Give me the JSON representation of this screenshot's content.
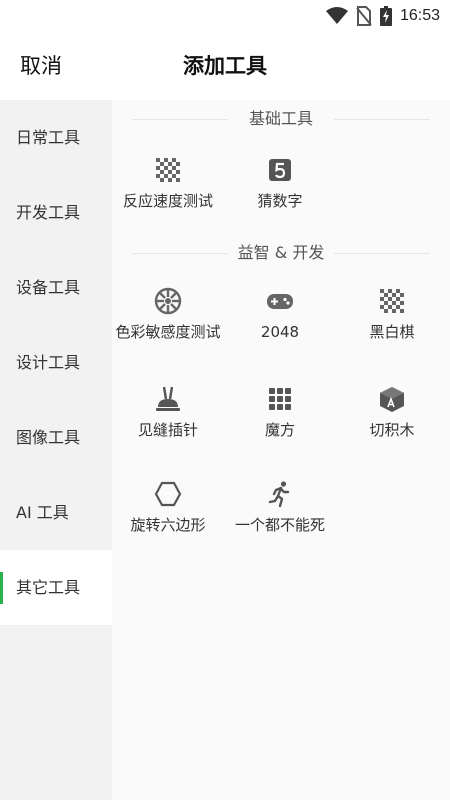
{
  "status_bar": {
    "time": "16:53",
    "icons": [
      "wifi-icon",
      "no-sim-icon",
      "battery-charging-icon"
    ]
  },
  "header": {
    "cancel_label": "取消",
    "title": "添加工具"
  },
  "sidebar": {
    "accent_color": "#2bb24c",
    "items": [
      {
        "label": "日常工具",
        "active": false
      },
      {
        "label": "开发工具",
        "active": false
      },
      {
        "label": "设备工具",
        "active": false
      },
      {
        "label": "设计工具",
        "active": false
      },
      {
        "label": "图像工具",
        "active": false
      },
      {
        "label": "AI 工具",
        "active": false
      },
      {
        "label": "其它工具",
        "active": true
      }
    ]
  },
  "sections": [
    {
      "title": "基础工具",
      "tools": [
        {
          "label": "反应速度测试",
          "icon": "checkerboard-icon"
        },
        {
          "label": "猜数字",
          "icon": "number-five-icon"
        }
      ]
    },
    {
      "title": "益智 & 开发",
      "tools": [
        {
          "label": "色彩敏感度测试",
          "icon": "color-wheel-icon"
        },
        {
          "label": "2048",
          "icon": "gamepad-icon"
        },
        {
          "label": "黑白棋",
          "icon": "checkerboard-icon"
        },
        {
          "label": "见缝插针",
          "icon": "pin-icon"
        },
        {
          "label": "魔方",
          "icon": "grid-icon"
        },
        {
          "label": "切积木",
          "icon": "block-cube-icon"
        },
        {
          "label": "旋转六边形",
          "icon": "hexagon-icon"
        },
        {
          "label": "一个都不能死",
          "icon": "running-icon"
        }
      ]
    }
  ]
}
